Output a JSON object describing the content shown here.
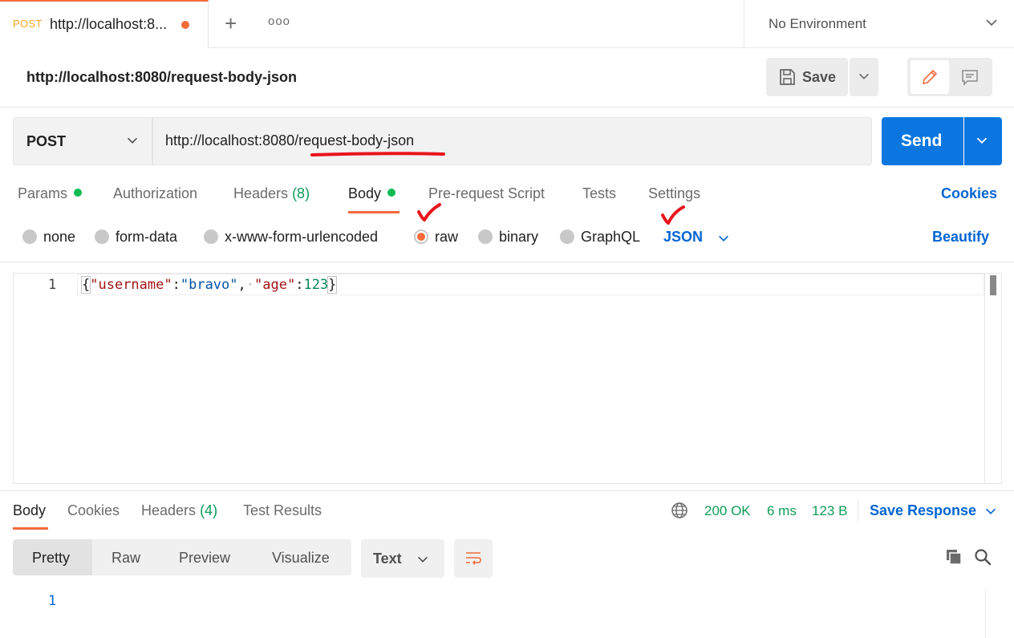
{
  "tab": {
    "method": "POST",
    "title": "http://localhost:8...",
    "new_tab": "+",
    "more": "ooo"
  },
  "environment": {
    "label": "No Environment"
  },
  "request": {
    "name": "http://localhost:8080/request-body-json",
    "save_label": "Save",
    "method": "POST",
    "url": "http://localhost:8080/request-body-json",
    "send_label": "Send"
  },
  "request_tabs": [
    {
      "label": "Params",
      "dot": true
    },
    {
      "label": "Authorization"
    },
    {
      "label": "Headers",
      "count": "(8)"
    },
    {
      "label": "Body",
      "dot": true,
      "active": true
    },
    {
      "label": "Pre-request Script"
    },
    {
      "label": "Tests"
    },
    {
      "label": "Settings"
    }
  ],
  "cookies_label": "Cookies",
  "body_types": [
    {
      "label": "none",
      "selected": false
    },
    {
      "label": "form-data",
      "selected": false
    },
    {
      "label": "x-www-form-urlencoded",
      "selected": false
    },
    {
      "label": "raw",
      "selected": true
    },
    {
      "label": "binary",
      "selected": false
    },
    {
      "label": "GraphQL",
      "selected": false
    }
  ],
  "raw_format": "JSON",
  "beautify_label": "Beautify",
  "editor": {
    "line_number": "1",
    "code": {
      "open": "{",
      "k1": "\"username\"",
      "c1": ":",
      "v1": "\"bravo\"",
      "comma": ",",
      "dot": "·",
      "k2": "\"age\"",
      "c2": ":",
      "v2": "123",
      "close": "}"
    }
  },
  "response": {
    "tabs": [
      {
        "label": "Body",
        "active": true
      },
      {
        "label": "Cookies"
      },
      {
        "label": "Headers",
        "count": "(4)"
      },
      {
        "label": "Test Results"
      }
    ],
    "status": "200 OK",
    "time": "6 ms",
    "size": "123 B",
    "save_response": "Save Response",
    "views": [
      "Pretty",
      "Raw",
      "Preview",
      "Visualize"
    ],
    "format": "Text",
    "line_number": "1"
  },
  "colors": {
    "accent_orange": "#f26b3a",
    "link_blue": "#0265d2",
    "send_blue": "#0b76e0",
    "status_green": "#0f9d58",
    "annotation_red": "#e8141c"
  }
}
